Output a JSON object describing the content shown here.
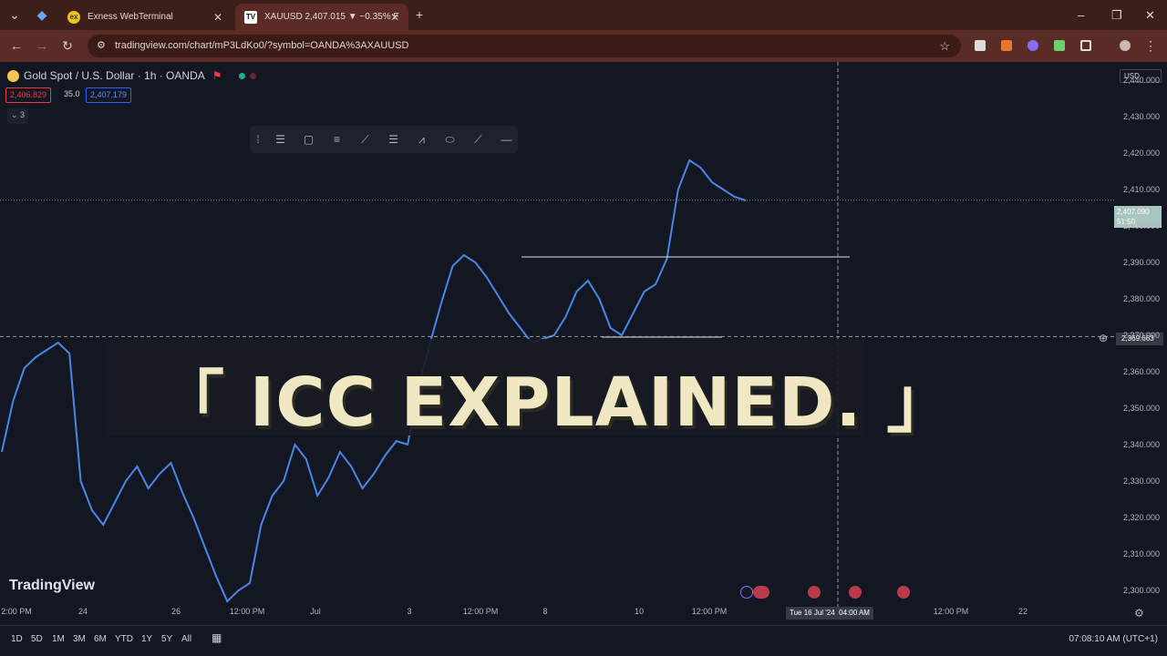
{
  "browser": {
    "tabs": [
      {
        "label": "Exness WebTerminal"
      },
      {
        "label": "XAUUSD 2,407.015 ▼ −0.35% F"
      }
    ],
    "url": "tradingview.com/chart/mP3LdKo0/?symbol=OANDA%3AXAUUSD"
  },
  "chart": {
    "symbol": "Gold Spot / U.S. Dollar · 1h · OANDA",
    "bid": "2,406.829",
    "spread": "35.0",
    "ask": "2,407.179",
    "indicator_count": "3",
    "currency": "USD",
    "current_price": "2,407.090",
    "countdown": "51:50",
    "crosshair_price": "2,369.663",
    "crosshair_date": "Tue 16 Jul '24",
    "crosshair_time": "04:00 AM",
    "overlay_title": "「 ICC EXPLAINED. 」",
    "brand": "TradingView"
  },
  "chart_data": {
    "type": "line",
    "yticks": [
      "2,440.000",
      "2,430.000",
      "2,420.000",
      "2,410.000",
      "2,400.000",
      "2,390.000",
      "2,380.000",
      "2,370.000",
      "2,360.000",
      "2,350.000",
      "2,340.000",
      "2,330.000",
      "2,320.000",
      "2,310.000",
      "2,300.000"
    ],
    "ylim": [
      2295,
      2445
    ],
    "xticks": [
      "2:00 PM",
      "24",
      "26",
      "12:00 PM",
      "Jul",
      "3",
      "12:00 PM",
      "8",
      "10",
      "12:00 PM",
      "12:00 PM",
      "22"
    ],
    "series": [
      {
        "values": [
          2338,
          2352,
          2361,
          2364,
          2366,
          2368,
          2365,
          2330,
          2322,
          2318,
          2324,
          2330,
          2334,
          2328,
          2332,
          2335,
          2327,
          2320,
          2312,
          2304,
          2297,
          2300,
          2302,
          2318,
          2326,
          2330,
          2340,
          2336,
          2326,
          2331,
          2338,
          2334,
          2328,
          2332,
          2337,
          2341,
          2340,
          2356,
          2368,
          2379,
          2389,
          2392,
          2390,
          2386,
          2381,
          2376,
          2372,
          2368,
          2369,
          2370,
          2375,
          2382,
          2385,
          2380,
          2372,
          2370,
          2376,
          2382,
          2384,
          2391,
          2410,
          2418,
          2416,
          2412,
          2410,
          2408,
          2407
        ]
      }
    ],
    "levels": [
      2391.5,
      2369.5
    ]
  },
  "bottom": {
    "ranges": [
      "1D",
      "5D",
      "1M",
      "3M",
      "6M",
      "YTD",
      "1Y",
      "5Y",
      "All"
    ],
    "clock": "07:08:10 AM (UTC+1)"
  },
  "colors": {
    "background": "#131722",
    "line": "#4a86e8",
    "overlay_text": "#efe8c2",
    "bid": "#f23645",
    "ask": "#2962ff",
    "current_price_label": "#a8c5c0"
  }
}
